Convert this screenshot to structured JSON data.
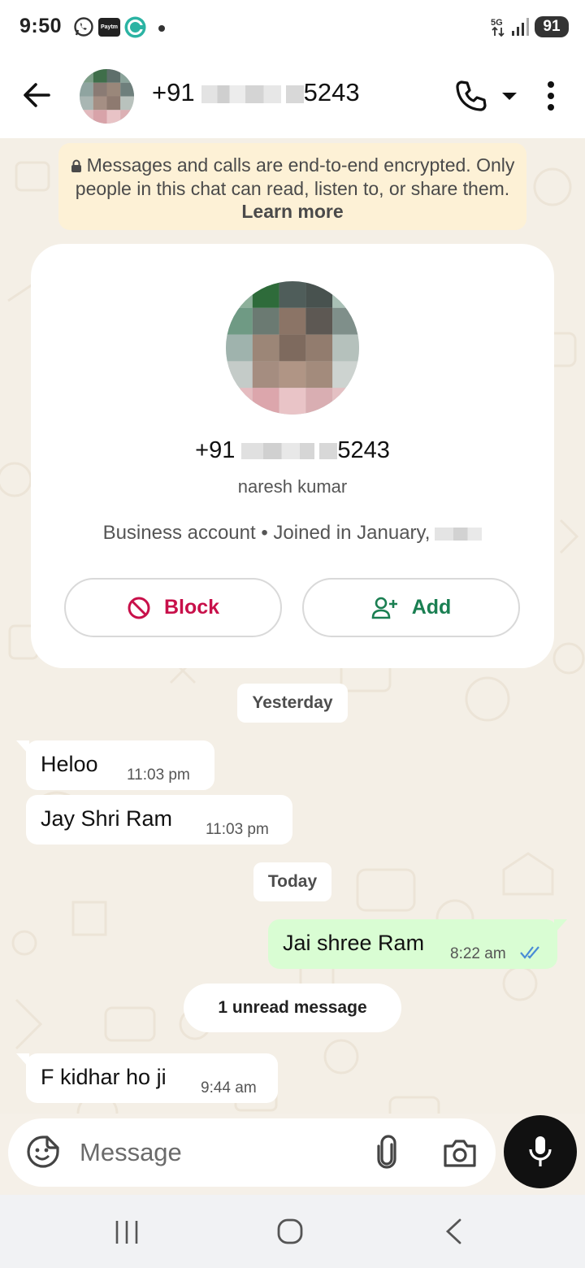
{
  "status_bar": {
    "time": "9:50",
    "battery": "91",
    "network": "5G",
    "icons": [
      "whatsapp-icon",
      "paytm-icon",
      "c-app-icon",
      "dot-icon",
      "5g-icon",
      "signal-icon",
      "battery-icon"
    ]
  },
  "header": {
    "title_prefix": "+91",
    "title_suffix": "5243",
    "icons": [
      "back-arrow-icon",
      "phone-icon",
      "chevron-down-icon",
      "more-vert-icon"
    ]
  },
  "encryption_notice": {
    "text": "Messages and calls are end-to-end encrypted. Only people in this chat can read, listen to, or share them.",
    "link": "Learn more"
  },
  "contact_card": {
    "phone_prefix": "+91",
    "phone_suffix": "5243",
    "name": "naresh kumar",
    "info": "Business account • Joined in January,",
    "block_label": "Block",
    "add_label": "Add"
  },
  "chips": {
    "yesterday": "Yesterday",
    "today": "Today",
    "unread": "1 unread message"
  },
  "messages": [
    {
      "direction": "in",
      "text": "Heloo",
      "time": "11:03 pm"
    },
    {
      "direction": "in",
      "text": "Jay Shri Ram",
      "time": "11:03 pm"
    },
    {
      "direction": "out",
      "text": "Jai shree Ram",
      "time": "8:22 am",
      "status": "read"
    },
    {
      "direction": "in",
      "text": "F kidhar ho ji",
      "time": "9:44 am"
    }
  ],
  "input": {
    "placeholder": "Message"
  },
  "colors": {
    "block_red": "#c8104a",
    "add_green": "#1a7f52",
    "outgoing_bubble": "#d9fdd3",
    "read_ticks": "#4a8cd6",
    "notice_bg": "#fdf1d6"
  }
}
